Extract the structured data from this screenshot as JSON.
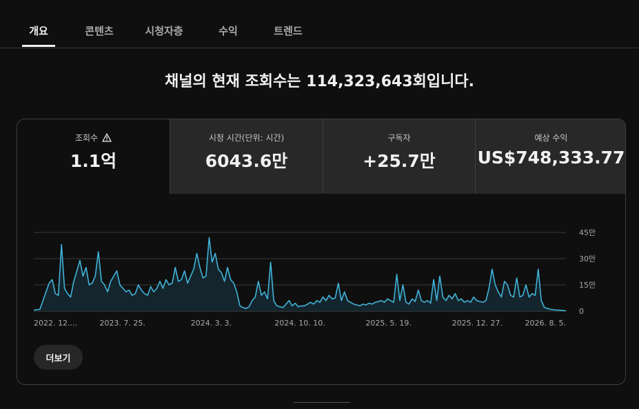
{
  "tabs": [
    {
      "label": "개요",
      "active": true
    },
    {
      "label": "콘텐츠",
      "active": false
    },
    {
      "label": "시청자층",
      "active": false
    },
    {
      "label": "수익",
      "active": false
    },
    {
      "label": "트렌드",
      "active": false
    }
  ],
  "headline": "채널의 현재 조회수는 114,323,643회입니다.",
  "metrics": [
    {
      "label": "조회수",
      "value": "1.1억",
      "icon": "warning-icon"
    },
    {
      "label": "시청 시간(단위: 시간)",
      "value": "6043.6만"
    },
    {
      "label": "구독자",
      "value": "+25.7만"
    },
    {
      "label": "예상 수익",
      "value": "US$748,333.77"
    }
  ],
  "more_button": "더보기",
  "colors": {
    "line": "#41b4d9",
    "area": "#14252d",
    "background": "#0f0f0f",
    "panel": "#282828"
  },
  "chart_data": {
    "type": "area",
    "x_tick_labels": [
      "2022. 12....",
      "2023. 7. 25.",
      "2024. 3. 3.",
      "2024. 10. 10.",
      "2025. 5. 19.",
      "2025. 12. 27.",
      "2026. 8. 5."
    ],
    "y_tick_labels": [
      "0",
      "15만",
      "30만",
      "45만"
    ],
    "ylim": [
      0,
      450000
    ],
    "grid": true,
    "series": [
      {
        "values": [
          5000,
          8000,
          10000,
          60000,
          110000,
          160000,
          180000,
          100000,
          90000,
          380000,
          130000,
          100000,
          80000,
          170000,
          230000,
          290000,
          200000,
          250000,
          150000,
          160000,
          200000,
          340000,
          170000,
          150000,
          110000,
          170000,
          200000,
          230000,
          150000,
          130000,
          110000,
          120000,
          90000,
          100000,
          150000,
          120000,
          100000,
          90000,
          140000,
          110000,
          130000,
          170000,
          130000,
          180000,
          150000,
          160000,
          250000,
          170000,
          180000,
          230000,
          160000,
          200000,
          240000,
          330000,
          250000,
          190000,
          200000,
          420000,
          280000,
          330000,
          240000,
          220000,
          170000,
          250000,
          180000,
          160000,
          110000,
          30000,
          20000,
          15000,
          25000,
          60000,
          80000,
          170000,
          90000,
          110000,
          70000,
          280000,
          60000,
          30000,
          25000,
          20000,
          40000,
          60000,
          30000,
          45000,
          25000,
          30000,
          30000,
          40000,
          50000,
          40000,
          60000,
          50000,
          80000,
          60000,
          90000,
          70000,
          75000,
          160000,
          60000,
          110000,
          60000,
          50000,
          40000,
          35000,
          30000,
          40000,
          35000,
          45000,
          40000,
          50000,
          55000,
          60000,
          50000,
          70000,
          60000,
          50000,
          210000,
          60000,
          150000,
          50000,
          40000,
          70000,
          55000,
          120000,
          60000,
          50000,
          60000,
          45000,
          180000,
          60000,
          200000,
          80000,
          60000,
          90000,
          70000,
          100000,
          60000,
          70000,
          50000,
          60000,
          50000,
          80000,
          60000,
          55000,
          50000,
          60000,
          130000,
          240000,
          150000,
          110000,
          80000,
          170000,
          150000,
          90000,
          80000,
          190000,
          80000,
          90000,
          150000,
          80000,
          100000,
          90000,
          240000,
          60000,
          20000,
          15000,
          10000,
          8000,
          5000,
          5000,
          3000,
          2000
        ]
      }
    ]
  }
}
